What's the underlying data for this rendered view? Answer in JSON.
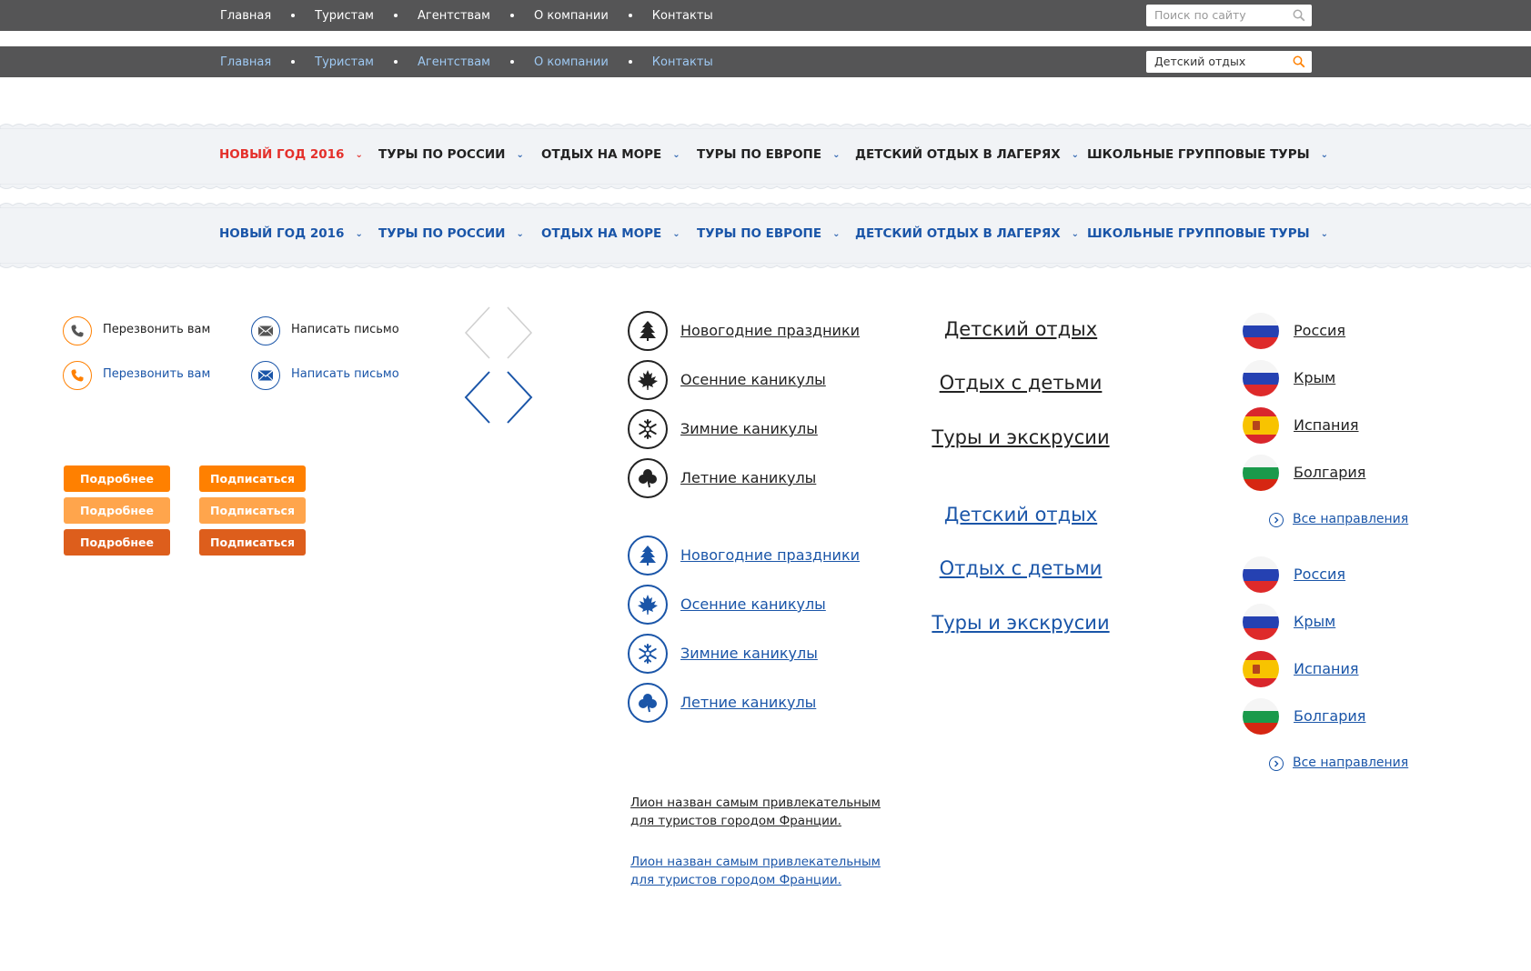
{
  "topnav": {
    "items": [
      "Главная",
      "Туристам",
      "Агентствам",
      "О компании",
      "Контакты"
    ],
    "search_placeholder": "Поиск по сайту",
    "search_value_active": "Детский отдых"
  },
  "menu": {
    "items": [
      "НОВЫЙ ГОД 2016",
      "ТУРЫ ПО РОССИИ",
      "ОТДЫХ НА МОРЕ",
      "ТУРЫ ПО ЕВРОПЕ",
      "ДЕТСКИЙ ОТДЫХ В ЛАГЕРЯХ",
      "ШКОЛЬНЫЕ ГРУППОВЫЕ ТУРЫ"
    ]
  },
  "contacts": {
    "callback": "Перезвонить вам",
    "write": "Написать письмо"
  },
  "buttons": {
    "details": "Подробнее",
    "subscribe": "Подписаться"
  },
  "seasons": [
    "Новогодние праздники",
    "Осенние каникулы",
    "Зимние каникулы",
    "Летние каникулы"
  ],
  "big_links": [
    "Детский отдых",
    "Отдых с детьми",
    "Туры и экскрусии"
  ],
  "destinations": {
    "items": [
      "Россия",
      "Крым",
      "Испания",
      "Болгария"
    ],
    "all": "Все направления"
  },
  "news": {
    "text": "Лион назван самым привлекательным для туристов городом Франции."
  },
  "colors": {
    "bar": "#555556",
    "link_blue": "#1a55a8",
    "orange": "#ff8000",
    "orange_light": "#ffa54c",
    "orange_dark": "#dd5e1c",
    "menu_red": "#e4302b"
  }
}
